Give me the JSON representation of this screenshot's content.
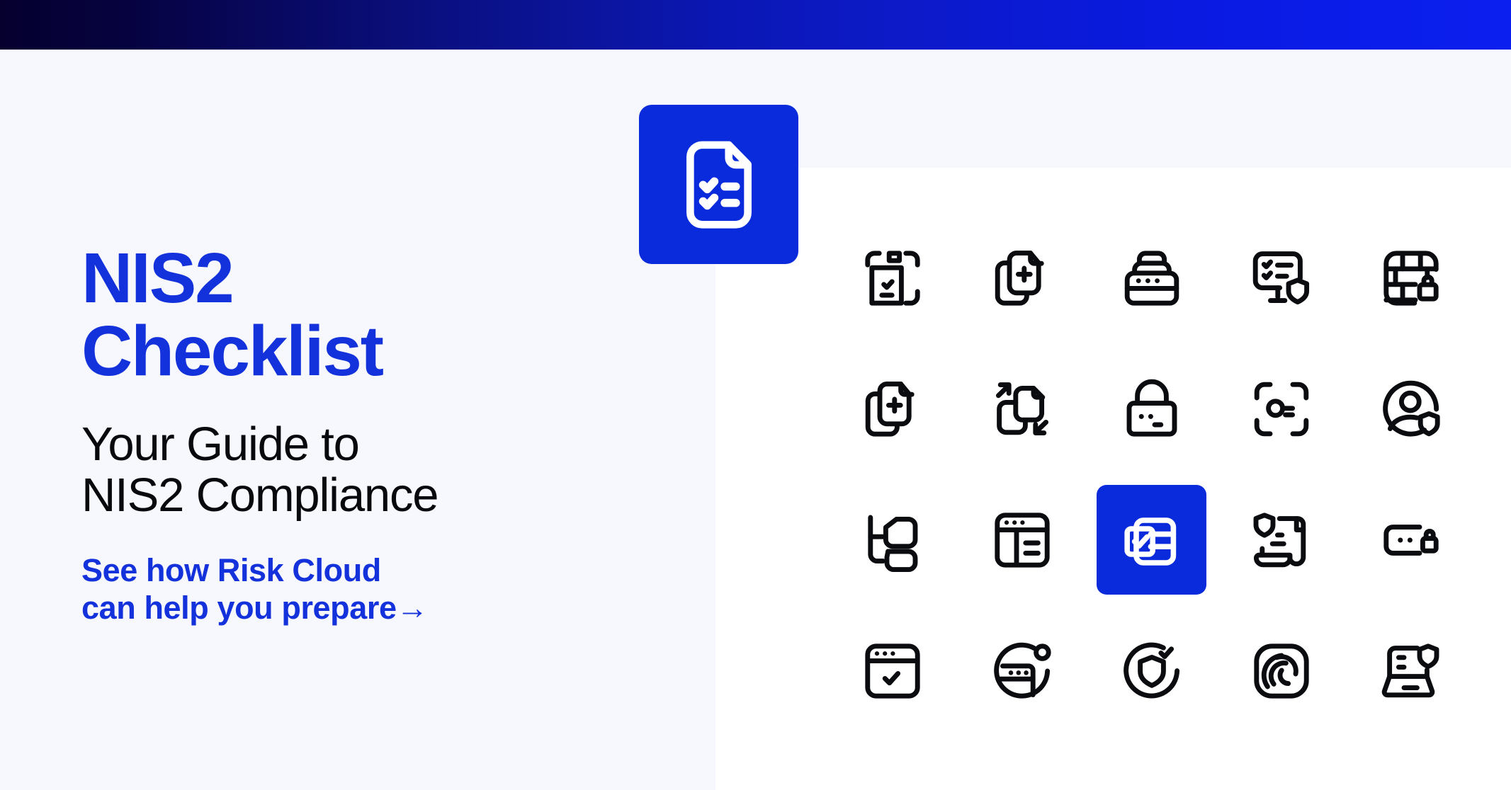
{
  "page": {
    "background_color": "#f6f8fd",
    "panel_color": "#ffffff",
    "accent_blue": "#0a2bdb",
    "headline_blue": "#1432dc",
    "topbar_gradient_from": "#05002e",
    "topbar_gradient_to": "#0b1fee"
  },
  "hero": {
    "headline": "NIS2\nChecklist",
    "subhead": "Your Guide to\nNIS2 Compliance",
    "cta_text": "See how Risk Cloud\ncan help you prepare",
    "cta_arrow": "→"
  },
  "doc_tile": {
    "icon": "document-checklist-icon",
    "background_color": "#0a2bdb"
  },
  "icon_grid": {
    "columns": 5,
    "rows": 4,
    "highlighted_index": 12,
    "items": [
      {
        "name": "scan-document-check-icon"
      },
      {
        "name": "copy-document-plus-icon"
      },
      {
        "name": "server-stack-password-icon"
      },
      {
        "name": "monitor-checklist-shield-icon"
      },
      {
        "name": "firewall-lock-icon"
      },
      {
        "name": "duplicate-document-plus-icon"
      },
      {
        "name": "transfer-documents-arrows-icon"
      },
      {
        "name": "padlock-password-icon"
      },
      {
        "name": "key-scan-frame-icon"
      },
      {
        "name": "user-profile-shield-icon"
      },
      {
        "name": "hierarchy-tree-icon"
      },
      {
        "name": "browser-layout-icon"
      },
      {
        "name": "checkbox-panel-icon"
      },
      {
        "name": "shield-scroll-certificate-icon"
      },
      {
        "name": "password-field-lock-icon"
      },
      {
        "name": "browser-check-icon"
      },
      {
        "name": "globe-password-icon"
      },
      {
        "name": "shield-circle-check-icon"
      },
      {
        "name": "fingerprint-icon"
      },
      {
        "name": "laptop-shield-icon"
      }
    ]
  }
}
